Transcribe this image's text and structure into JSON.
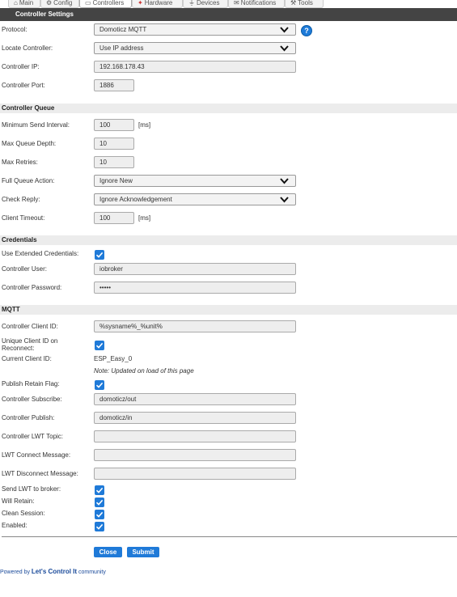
{
  "tabs": [
    {
      "label": "Main",
      "icon": "home-icon"
    },
    {
      "label": "Config",
      "icon": "gear-icon"
    },
    {
      "label": "Controllers",
      "icon": "comment-icon"
    },
    {
      "label": "Hardware",
      "icon": "pin-icon"
    },
    {
      "label": "Devices",
      "icon": "plug-icon"
    },
    {
      "label": "Notifications",
      "icon": "mail-icon"
    },
    {
      "label": "Tools",
      "icon": "wrench-icon"
    }
  ],
  "page_title": "Controller Settings",
  "controller": {
    "protocol_label": "Protocol:",
    "protocol_value": "Domoticz MQTT",
    "help_symbol": "?",
    "locate_label": "Locate Controller:",
    "locate_value": "Use IP address",
    "ip_label": "Controller IP:",
    "ip_value": "192.168.178.43",
    "port_label": "Controller Port:",
    "port_value": "1886"
  },
  "queue": {
    "section_title": "Controller Queue",
    "min_interval_label": "Minimum Send Interval:",
    "min_interval_value": "100",
    "min_interval_unit": "[ms]",
    "max_depth_label": "Max Queue Depth:",
    "max_depth_value": "10",
    "max_retries_label": "Max Retries:",
    "max_retries_value": "10",
    "full_action_label": "Full Queue Action:",
    "full_action_value": "Ignore New",
    "check_reply_label": "Check Reply:",
    "check_reply_value": "Ignore Acknowledgement",
    "client_timeout_label": "Client Timeout:",
    "client_timeout_value": "100",
    "client_timeout_unit": "[ms]"
  },
  "credentials": {
    "section_title": "Credentials",
    "extended_label": "Use Extended Credentials:",
    "extended_checked": true,
    "user_label": "Controller User:",
    "user_value": "iobroker",
    "password_label": "Controller Password:",
    "password_value": "•••••"
  },
  "mqtt": {
    "section_title": "MQTT",
    "client_id_label": "Controller Client ID:",
    "client_id_value": "%sysname%_%unit%",
    "unique_id_label": "Unique Client ID on Reconnect:",
    "unique_id_checked": true,
    "current_id_label": "Current Client ID:",
    "current_id_value": "ESP_Easy_0",
    "current_id_note": "Note: Updated on load of this page",
    "retain_label": "Publish Retain Flag:",
    "retain_checked": true,
    "subscribe_label": "Controller Subscribe:",
    "subscribe_value": "domoticz/out",
    "publish_label": "Controller Publish:",
    "publish_value": "domoticz/in",
    "lwt_topic_label": "Controller LWT Topic:",
    "lwt_topic_value": "",
    "lwt_connect_label": "LWT Connect Message:",
    "lwt_connect_value": "",
    "lwt_disconnect_label": "LWT Disconnect Message:",
    "lwt_disconnect_value": "",
    "send_lwt_label": "Send LWT to broker:",
    "send_lwt_checked": true,
    "will_retain_label": "Will Retain:",
    "will_retain_checked": true,
    "clean_session_label": "Clean Session:",
    "clean_session_checked": true,
    "enabled_label": "Enabled:",
    "enabled_checked": true
  },
  "buttons": {
    "close": "Close",
    "submit": "Submit"
  },
  "footer": {
    "prefix": "Powered by ",
    "brand": "Let's Control It",
    "suffix": " community"
  },
  "colors": {
    "accent": "#1f7ad8",
    "title_bar": "#444444",
    "section_bg": "#ececec"
  }
}
